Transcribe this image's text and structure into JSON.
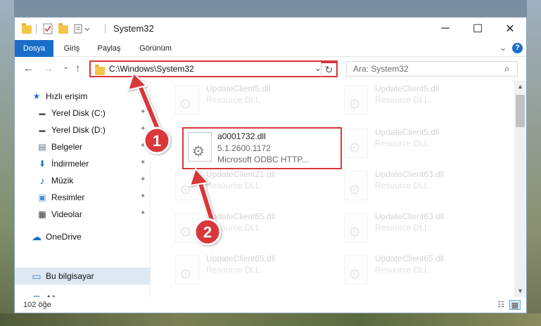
{
  "window": {
    "title": "System32",
    "controls": {
      "minimize": "─",
      "maximize": "☐",
      "close": "✕"
    }
  },
  "ribbon": {
    "tabs": [
      "Dosya",
      "Giriş",
      "Paylaş",
      "Görünüm"
    ],
    "expand_glyph": "⌄",
    "help_glyph": "?"
  },
  "nav": {
    "back_glyph": "←",
    "forward_glyph": "→",
    "recent_glyph": "⌄",
    "up_glyph": "↑",
    "address": "C:\\Windows\\System32",
    "address_chevron": "⌄",
    "refresh_glyph": "↻",
    "search_placeholder": "Ara: System32",
    "search_glyph": "⌕"
  },
  "sidebar": {
    "items": [
      {
        "label": "Hızlı erişim",
        "icon": "star-icon",
        "glyph": "★",
        "color": "#2f6fd1"
      },
      {
        "label": "Yerel Disk (C:)",
        "icon": "drive-icon",
        "glyph": "▬",
        "color": "#555555"
      },
      {
        "label": "Yerel Disk (D:)",
        "icon": "drive-icon",
        "glyph": "▬",
        "color": "#555555"
      },
      {
        "label": "Belgeler",
        "icon": "document-icon",
        "glyph": "▤",
        "color": "#5a6f8a"
      },
      {
        "label": "İndirmeler",
        "icon": "download-icon",
        "glyph": "⬇",
        "color": "#1a6ec7"
      },
      {
        "label": "Müzik",
        "icon": "music-icon",
        "glyph": "♪",
        "color": "#1a6ec7"
      },
      {
        "label": "Resimler",
        "icon": "pictures-icon",
        "glyph": "▣",
        "color": "#4a8fcf"
      },
      {
        "label": "Videolar",
        "icon": "video-icon",
        "glyph": "▦",
        "color": "#333333"
      },
      {
        "label": "OneDrive",
        "icon": "cloud-icon",
        "glyph": "☁",
        "color": "#1a6ec7"
      },
      {
        "label": "Bu bilgisayar",
        "icon": "computer-icon",
        "glyph": "▭",
        "color": "#3a7fc8"
      },
      {
        "label": "Ağ",
        "icon": "network-icon",
        "glyph": "⊞",
        "color": "#3a7fc8"
      }
    ],
    "pin_glyph": "✦"
  },
  "files": [
    {
      "name": "UpdateClient5.dll",
      "desc": "Resource DLL"
    },
    {
      "name": "UpdateClient5.dll",
      "desc": "Resource DLL"
    },
    {
      "name": "UpdateClient5.dll",
      "desc": "Resource DLL"
    },
    {
      "name": "a0001732.dll",
      "desc": "5.1.2600.1172",
      "extra": "Microsoft ODBC HTTP..."
    },
    {
      "name": "UpdateClient21.dll",
      "desc": "Resource DLL"
    },
    {
      "name": "UpdateClient63.dll",
      "desc": "Resource DLL"
    },
    {
      "name": "UpdateClient65.dll",
      "desc": "Resource DLL"
    },
    {
      "name": "UpdateClient63.dll",
      "desc": "Resource DLL"
    },
    {
      "name": "UpdateClient65.dll",
      "desc": "Resource DLL"
    },
    {
      "name": "UpdateClient65.dll",
      "desc": "Resource DLL"
    }
  ],
  "file_gear_glyph": "⚙",
  "scroll": {
    "up_glyph": "▲",
    "down_glyph": "▼"
  },
  "status": {
    "count": "102 öğe",
    "details_glyph": "☷",
    "tiles_glyph": "▦"
  },
  "annotations": {
    "badge1": "1",
    "badge2": "2",
    "color": "#d9373a"
  }
}
